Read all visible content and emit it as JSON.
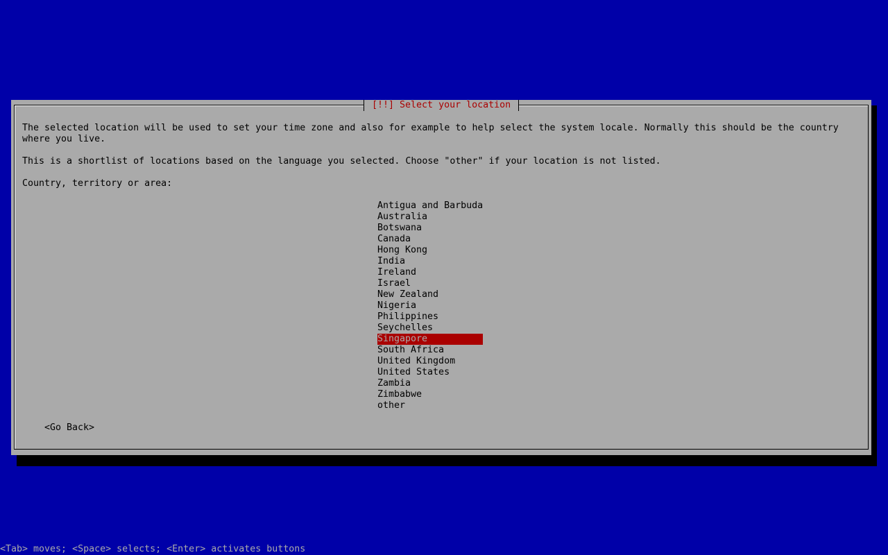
{
  "dialog": {
    "title": "[!!] Select your location",
    "description_line1": "The selected location will be used to set your time zone and also for example to help select the system locale. Normally this should be the country",
    "description_line2": "where you live.",
    "shortlist_note": "This is a shortlist of locations based on the language you selected. Choose \"other\" if your location is not listed.",
    "prompt": "Country, territory or area:",
    "locations": [
      "Antigua and Barbuda",
      "Australia",
      "Botswana",
      "Canada",
      "Hong Kong",
      "India",
      "Ireland",
      "Israel",
      "New Zealand",
      "Nigeria",
      "Philippines",
      "Seychelles",
      "Singapore",
      "South Africa",
      "United Kingdom",
      "United States",
      "Zambia",
      "Zimbabwe",
      "other"
    ],
    "selected_location": "Singapore",
    "go_back_label": "<Go Back>"
  },
  "statusbar": {
    "help_text": "<Tab> moves; <Space> selects; <Enter> activates buttons"
  },
  "colors": {
    "background": "#0000a8",
    "dialog": "#aaaaaa",
    "highlight": "#aa0000",
    "title": "#aa0000"
  }
}
